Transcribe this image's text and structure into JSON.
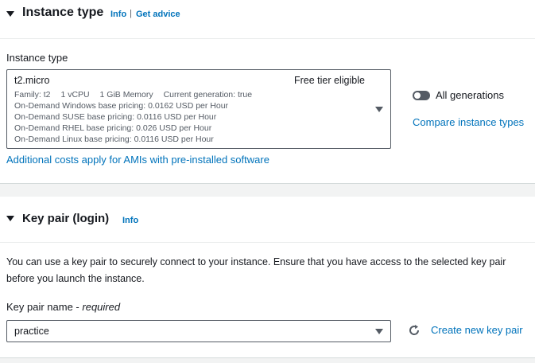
{
  "instance_type": {
    "title": "Instance type",
    "info": "Info",
    "separator": "|",
    "get_advice": "Get advice",
    "field_label": "Instance type",
    "selected": {
      "name": "t2.micro",
      "badge": "Free tier eligible",
      "family": "Family: t2",
      "vcpu": "1 vCPU",
      "memory": "1 GiB Memory",
      "generation": "Current generation: true",
      "pricing": [
        "On-Demand Windows base pricing: 0.0162 USD per Hour",
        "On-Demand SUSE base pricing: 0.0116 USD per Hour",
        "On-Demand RHEL base pricing: 0.026 USD per Hour",
        "On-Demand Linux base pricing: 0.0116 USD per Hour"
      ]
    },
    "toggle_label": "All generations",
    "compare_link": "Compare instance types",
    "costs_link": "Additional costs apply for AMIs with pre-installed software"
  },
  "key_pair": {
    "title": "Key pair (login)",
    "info": "Info",
    "description_line1": "You can use a key pair to securely connect to your instance. Ensure that you have access to the selected key pair",
    "description_line2": "before you launch the instance.",
    "field_label": "Key pair name -",
    "field_label_required": "required",
    "selected_value": "practice",
    "create_link": "Create new key pair"
  },
  "colors": {
    "link": "#0073bb",
    "text": "#16191f",
    "muted": "#545b64",
    "background": "#f2f3f3"
  }
}
